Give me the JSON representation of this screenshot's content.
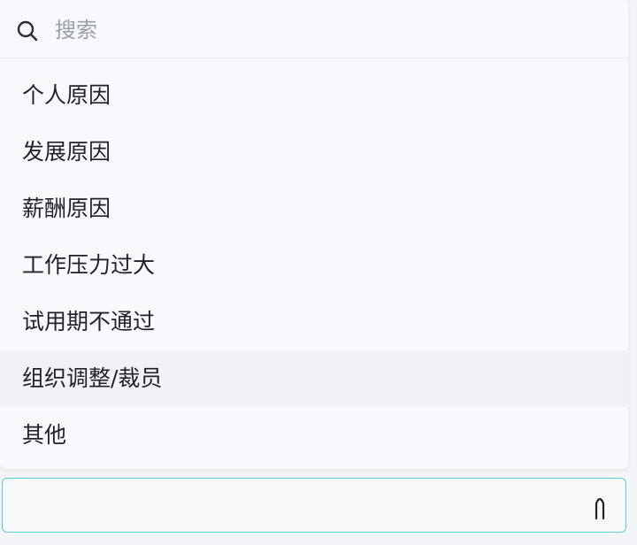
{
  "search": {
    "placeholder": "搜索",
    "icon": "search-icon"
  },
  "options": [
    {
      "label": "个人原因"
    },
    {
      "label": "发展原因"
    },
    {
      "label": "薪酬原因"
    },
    {
      "label": "工作压力过大"
    },
    {
      "label": "试用期不通过"
    },
    {
      "label": "组织调整/裁员"
    },
    {
      "label": "其他"
    }
  ],
  "select": {
    "value": "",
    "icon": "chevron-up-icon",
    "border_color": "#5ccfd0"
  }
}
